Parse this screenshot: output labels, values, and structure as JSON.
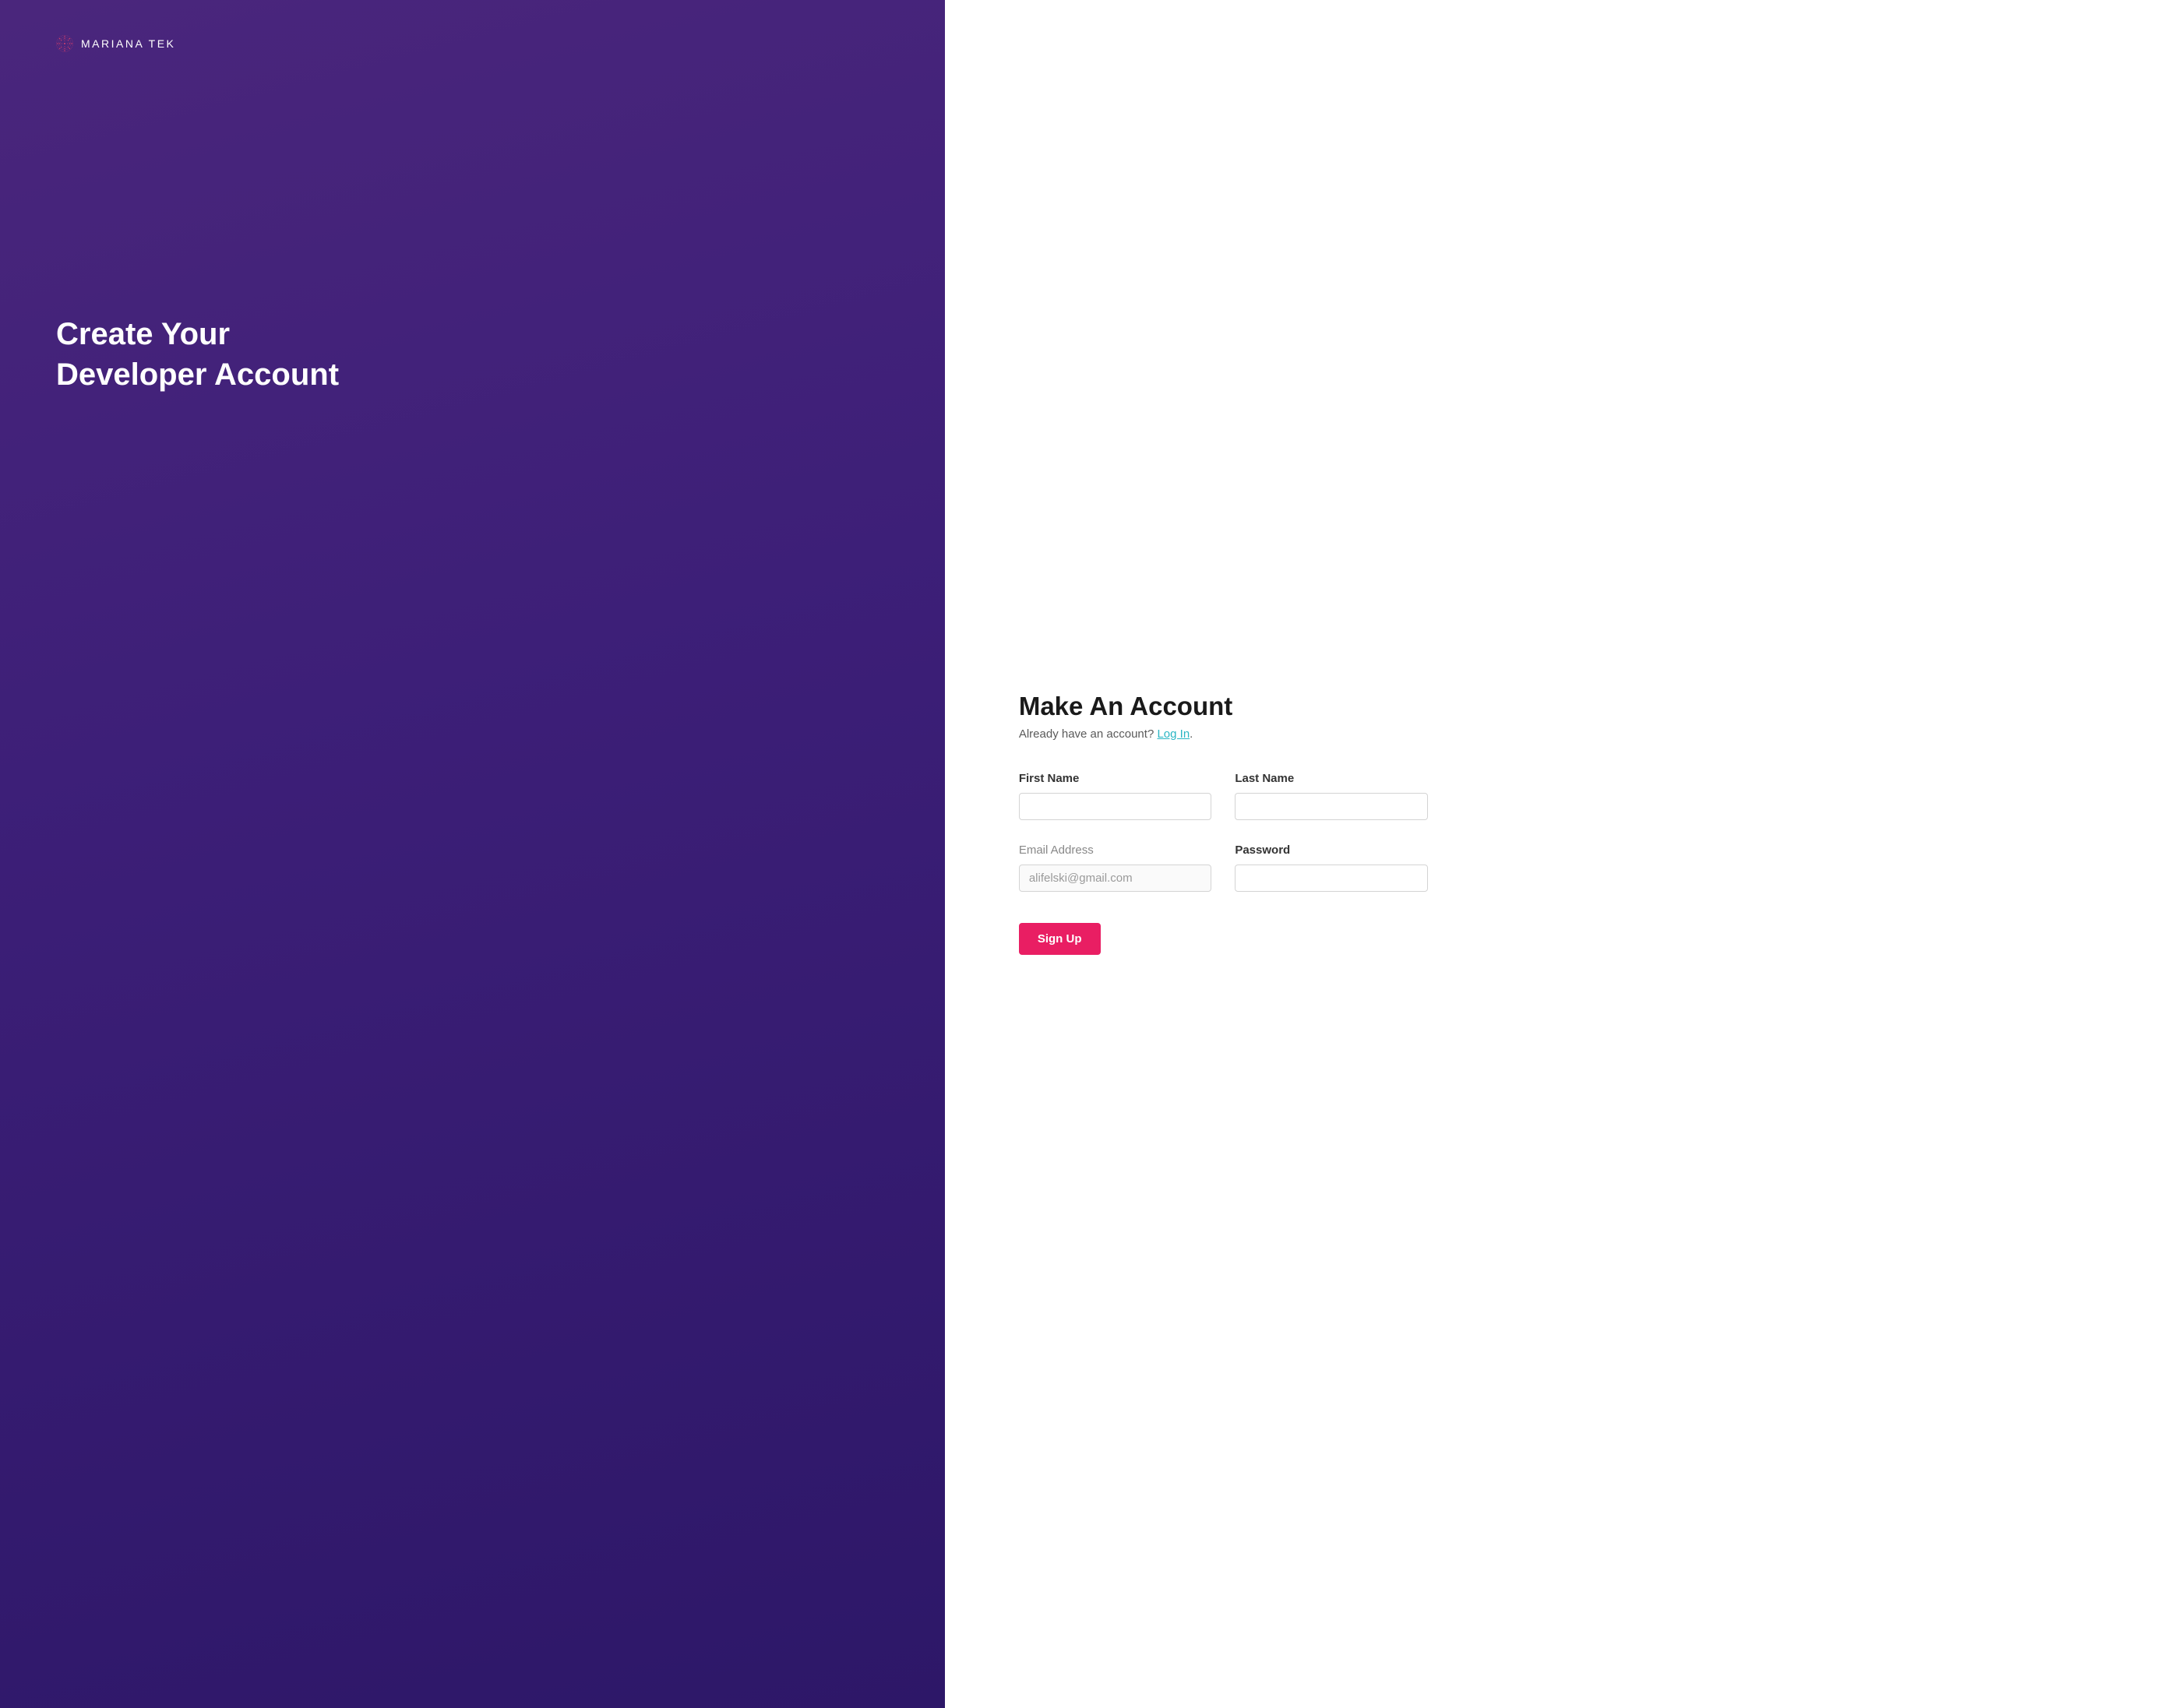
{
  "brand": {
    "logo_text": "MARIANA TEK"
  },
  "left": {
    "heading_line1": "Create Your",
    "heading_line2": "Developer Account"
  },
  "form": {
    "heading": "Make An Account",
    "subtext_prefix": "Already have an account?  ",
    "login_link": "Log In",
    "subtext_suffix": ".",
    "fields": {
      "first_name": {
        "label": "First Name",
        "value": ""
      },
      "last_name": {
        "label": "Last Name",
        "value": ""
      },
      "email": {
        "label": "Email Address",
        "value": "alifelski@gmail.com"
      },
      "password": {
        "label": "Password",
        "value": ""
      }
    },
    "submit_label": "Sign Up"
  },
  "colors": {
    "accent_pink": "#e91e63",
    "link_teal": "#2bb6c4",
    "bg_purple_start": "#4a267c",
    "bg_purple_end": "#2d1768"
  }
}
